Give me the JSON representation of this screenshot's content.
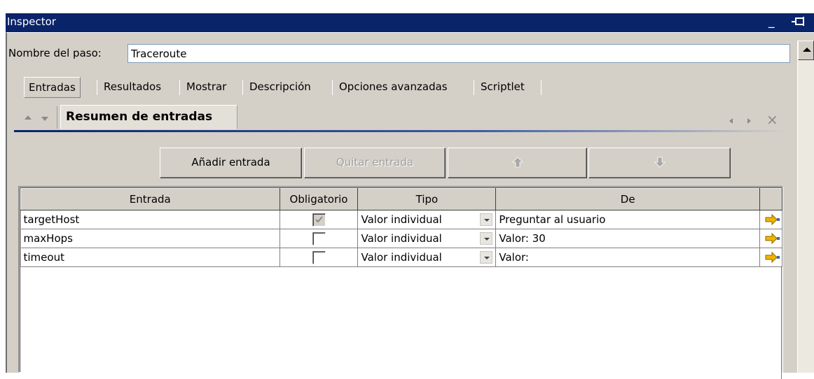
{
  "window": {
    "title": "Inspector",
    "minimize_glyph": "_"
  },
  "step": {
    "label": "Nombre del paso:",
    "value": "Traceroute"
  },
  "tabs": [
    {
      "label": "Entradas",
      "active": true
    },
    {
      "label": "Resultados"
    },
    {
      "label": "Mostrar"
    },
    {
      "label": "Descripción"
    },
    {
      "label": "Opciones avanzadas"
    },
    {
      "label": "Scriptlet"
    }
  ],
  "section": {
    "title": "Resumen de entradas",
    "close_glyph": "×"
  },
  "toolbar": {
    "add_label": "Añadir entrada",
    "remove_label": "Quitar entrada"
  },
  "grid": {
    "columns": [
      "Entrada",
      "Obligatorio",
      "Tipo",
      "De",
      ""
    ],
    "rows": [
      {
        "entrada": "targetHost",
        "obligatorio": true,
        "tipo": "Valor individual",
        "de": "Preguntar al usuario"
      },
      {
        "entrada": "maxHops",
        "obligatorio": false,
        "tipo": "Valor individual",
        "de": "Valor: 30"
      },
      {
        "entrada": "timeout",
        "obligatorio": false,
        "tipo": "Valor individual",
        "de": "Valor:"
      }
    ]
  },
  "colors": {
    "titlebar": "#0a246a",
    "panel": "#d4d0c8",
    "accent_arrow": "#f0b400"
  }
}
